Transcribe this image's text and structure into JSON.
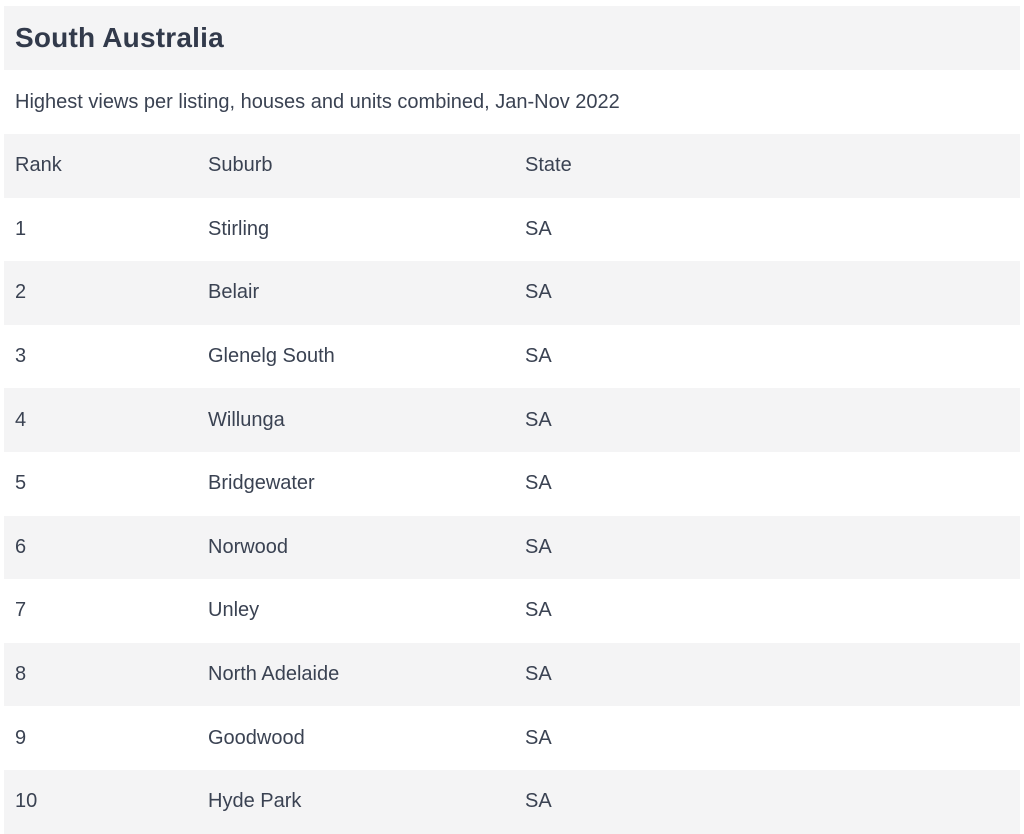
{
  "header": {
    "title": "South Australia",
    "subtitle": "Highest views per listing, houses and units combined, Jan-Nov 2022"
  },
  "table": {
    "columns": [
      "Rank",
      "Suburb",
      "State"
    ],
    "rows": [
      {
        "rank": "1",
        "suburb": "Stirling",
        "state": "SA"
      },
      {
        "rank": "2",
        "suburb": "Belair",
        "state": "SA"
      },
      {
        "rank": "3",
        "suburb": "Glenelg South",
        "state": "SA"
      },
      {
        "rank": "4",
        "suburb": "Willunga",
        "state": "SA"
      },
      {
        "rank": "5",
        "suburb": "Bridgewater",
        "state": "SA"
      },
      {
        "rank": "6",
        "suburb": "Norwood",
        "state": "SA"
      },
      {
        "rank": "7",
        "suburb": "Unley",
        "state": "SA"
      },
      {
        "rank": "8",
        "suburb": "North Adelaide",
        "state": "SA"
      },
      {
        "rank": "9",
        "suburb": "Goodwood",
        "state": "SA"
      },
      {
        "rank": "10",
        "suburb": "Hyde Park",
        "state": "SA"
      }
    ]
  },
  "colors": {
    "stripe": "#f4f4f5",
    "text": "#3a4252",
    "title": "#323a4b"
  }
}
